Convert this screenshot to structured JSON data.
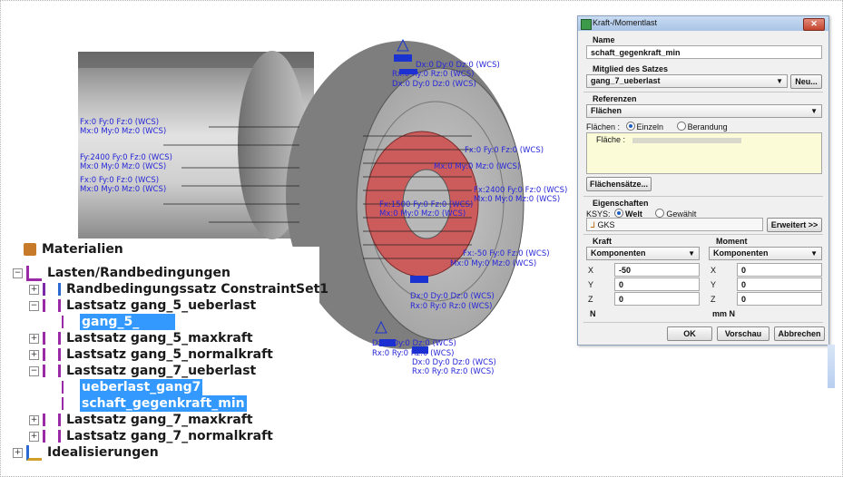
{
  "viewport": {
    "callouts": [
      {
        "id": "top1",
        "line1": "Dx:0 Dy:0 Dz:0 (WCS)",
        "line2": "Rx:0 Ry:0 Rz:0 (WCS)"
      },
      {
        "id": "top2",
        "line1": "Dx:0 Dy:0 Dz:0 (WCS)",
        "line2": "Rx:0 Ry:0 Rz:0 (WCS)"
      },
      {
        "id": "left1",
        "line1": "Fx:0 Fy:0 Fz:0 (WCS)",
        "line2": "Mx:0 My:0 Mz:0 (WCS)"
      },
      {
        "id": "left2",
        "line1": "Fy:2400 Fy:0 Fz:0 (WCS)",
        "line2": "Mx:0 My:0 Mz:0 (WCS)"
      },
      {
        "id": "left3",
        "line1": "Fx:0 Fy:0 Fz:0 (WCS)",
        "line2": "Mx:0 My:0 Mz:0 (WCS)"
      },
      {
        "id": "mid1",
        "line1": "Fx:0 Fy:0 Fz:0 (WCS)",
        "line2": "Mx:0 My:0 Mz:0 (WCS)"
      },
      {
        "id": "mid2",
        "line1": "Fx:2400 Fy:0 Fz:0 (WCS)",
        "line2": "Mx:0 My:0 Mz:0 (WCS)"
      },
      {
        "id": "center",
        "line1": "Fx:1500 Fy:0 Fz:0 (WCS)",
        "line2": "Mx:0 My:0 Mz:0 (WCS)"
      },
      {
        "id": "right1",
        "line1": "Fx:-50 Fy:0 Fz:0 (WCS)",
        "line2": "Mx:0 My:0 Mz:0 (WCS)"
      },
      {
        "id": "bottom1",
        "line1": "Dx:0 Dy:0 Dz:0 (WCS)",
        "line2": "Rx:0 Ry:0 Rz:0 (WCS)"
      },
      {
        "id": "bottom2",
        "line1": "Dx:0 Dy:0 Dz:0 (WCS)",
        "line2": "Rx:0 Ry:0 Rz:0 (WCS)"
      },
      {
        "id": "bottom3",
        "line1": "Dx:0 Dy:0 Dz:0 (WCS)",
        "line2": "Rx:0 Ry:0 Rz:0 (WCS)"
      }
    ]
  },
  "tree": {
    "items": [
      {
        "label": "Materialien",
        "level": 0,
        "expander": "",
        "icon": "material-icon",
        "selected": false,
        "partial": true
      },
      {
        "label": "Lasten/Randbedingungen",
        "level": 0,
        "expander": "−",
        "icon": "loads-icon",
        "selected": false
      },
      {
        "label": "Randbedingungssatz ConstraintSet1",
        "level": 1,
        "expander": "+",
        "icon": "constraint-set-icon",
        "selected": false
      },
      {
        "label": "Lastsatz gang_5_ueberlast",
        "level": 1,
        "expander": "−",
        "icon": "load-set-icon",
        "selected": false
      },
      {
        "label": "gang_5_",
        "level": 2,
        "expander": "",
        "icon": "load-icon",
        "selected": true,
        "blurred": true
      },
      {
        "label": "Lastsatz gang_5_maxkraft",
        "level": 1,
        "expander": "+",
        "icon": "load-set-icon",
        "selected": false
      },
      {
        "label": "Lastsatz gang_5_normalkraft",
        "level": 1,
        "expander": "+",
        "icon": "load-set-icon",
        "selected": false
      },
      {
        "label": "Lastsatz gang_7_ueberlast",
        "level": 1,
        "expander": "−",
        "icon": "load-set-icon",
        "selected": false
      },
      {
        "label": "ueberlast_gang7",
        "level": 2,
        "expander": "",
        "icon": "load-icon",
        "selected": true
      },
      {
        "label": "schaft_gegenkraft_min",
        "level": 2,
        "expander": "",
        "icon": "load-icon",
        "selected": true
      },
      {
        "label": "Lastsatz gang_7_maxkraft",
        "level": 1,
        "expander": "+",
        "icon": "load-set-icon",
        "selected": false
      },
      {
        "label": "Lastsatz gang_7_normalkraft",
        "level": 1,
        "expander": "+",
        "icon": "load-set-icon",
        "selected": false
      },
      {
        "label": "Idealisierungen",
        "level": 0,
        "expander": "+",
        "icon": "idealization-icon",
        "selected": false
      }
    ]
  },
  "dialog": {
    "title": "Kraft-/Momentlast",
    "close_label": "✕",
    "name_label": "Name",
    "name_value": "schaft_gegenkraft_min",
    "member_label": "Mitglied des Satzes",
    "member_value": "gang_7_ueberlast",
    "new_button": "Neu...",
    "refs_label": "Referenzen",
    "refs_value": "Flächen",
    "surfaces_label": "Flächen :",
    "radio_single": "Einzeln",
    "radio_boundary": "Berandung",
    "surface_list_label": "Fläche :",
    "surface_sets_button": "Flächensätze...",
    "props_label": "Eigenschaften",
    "ksys_label": "KSYS:",
    "radio_world": "Welt",
    "radio_selected": "Gewählt",
    "csys_value": "GKS",
    "advanced_button": "Erweitert >>",
    "force_label": "Kraft",
    "moment_label": "Moment",
    "force_mode": "Komponenten",
    "moment_mode": "Komponenten",
    "x_label": "X",
    "y_label": "Y",
    "z_label": "Z",
    "force_x": "-50",
    "force_y": "0",
    "force_z": "0",
    "moment_x": "0",
    "moment_y": "0",
    "moment_z": "0",
    "force_unit": "N",
    "moment_unit": "mm N",
    "ok_button": "OK",
    "preview_button": "Vorschau",
    "cancel_button": "Abbrechen"
  }
}
